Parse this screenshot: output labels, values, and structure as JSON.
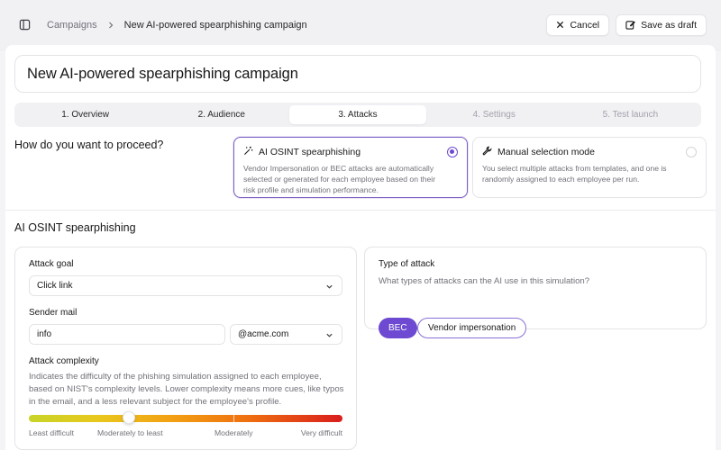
{
  "breadcrumb": {
    "parent": "Campaigns",
    "current": "New AI-powered spearphishing campaign"
  },
  "actions": {
    "cancel_label": "Cancel",
    "save_label": "Save as draft"
  },
  "page": {
    "title": "New AI-powered spearphishing campaign"
  },
  "steps": [
    {
      "label": "1. Overview",
      "state": "done"
    },
    {
      "label": "2. Audience",
      "state": "done"
    },
    {
      "label": "3. Attacks",
      "state": "active"
    },
    {
      "label": "4. Settings",
      "state": "disabled"
    },
    {
      "label": "5. Test launch",
      "state": "disabled"
    }
  ],
  "proceed": {
    "question": "How do you want to proceed?",
    "options": [
      {
        "title": "AI OSINT spearphishing",
        "description": "Vendor Impersonation or BEC attacks are automatically selected or generated for each employee based on their risk profile and simulation performance.",
        "selected": true,
        "icon": "magic-wand-icon"
      },
      {
        "title": "Manual selection mode",
        "description": "You select multiple attacks from templates, and one is randomly assigned to each employee per run.",
        "selected": false,
        "icon": "wrench-icon"
      }
    ]
  },
  "section": {
    "title": "AI OSINT spearphishing"
  },
  "attack_config": {
    "goal_label": "Attack goal",
    "goal_value": "Click link",
    "sender_label": "Sender mail",
    "sender_local": "info",
    "sender_domain": "@acme.com",
    "complexity_label": "Attack complexity",
    "complexity_description": "Indicates the difficulty of the phishing simulation assigned to each employee, based on NIST's complexity levels. Lower complexity means more cues, like typos in the email, and a less relevant subject for the employee's profile.",
    "complexity_level": 0.32,
    "complexity_scale": [
      "Least difficult",
      "Moderately to least",
      "Moderately",
      "Very difficult"
    ]
  },
  "attack_type": {
    "label": "Type of attack",
    "question": "What types of attacks can the AI use in this simulation?",
    "chips": [
      {
        "label": "BEC",
        "selected": true
      },
      {
        "label": "Vendor impersonation",
        "selected": false
      }
    ]
  },
  "colors": {
    "accent": "#6d4ad1",
    "selected_border": "#7c5cc4",
    "slider_start": "#c8d429",
    "slider_end": "#d91d1d"
  }
}
